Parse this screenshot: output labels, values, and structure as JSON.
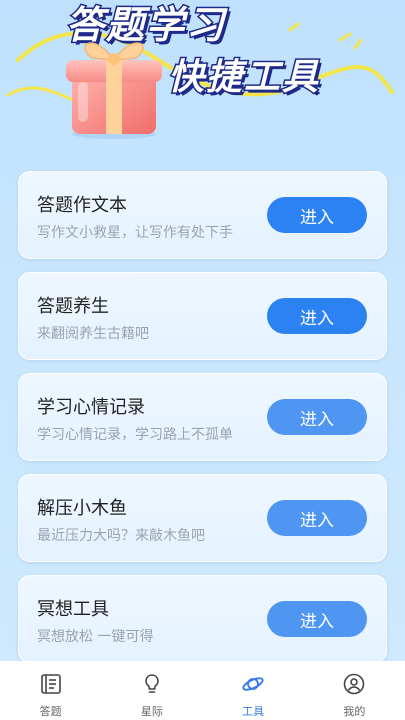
{
  "banner": {
    "title_line1": "答题学习",
    "title_line2": "快捷工具"
  },
  "colors": {
    "accent": "#2c82f2",
    "active_tab": "#3479ea",
    "background": "#c8e6fd",
    "squiggle": "#f2e64a"
  },
  "tools": [
    {
      "name": "答题作文本",
      "desc": "写作文小救星，让写作有处下手",
      "button": "进入"
    },
    {
      "name": "答题养生",
      "desc": "来翻阅养生古籍吧",
      "button": "进入"
    },
    {
      "name": "学习心情记录",
      "desc": "学习心情记录，学习路上不孤单",
      "button": "进入"
    },
    {
      "name": "解压小木鱼",
      "desc": "最近压力大吗？来敲木鱼吧",
      "button": "进入"
    },
    {
      "name": "冥想工具",
      "desc": "冥想放松 一键可得",
      "button": "进入"
    }
  ],
  "tabs": [
    {
      "label": "答题",
      "icon": "answer-book-icon",
      "active": false
    },
    {
      "label": "星际",
      "icon": "lightbulb-icon",
      "active": false
    },
    {
      "label": "工具",
      "icon": "planet-orbit-icon",
      "active": true
    },
    {
      "label": "我的",
      "icon": "profile-icon",
      "active": false
    }
  ]
}
